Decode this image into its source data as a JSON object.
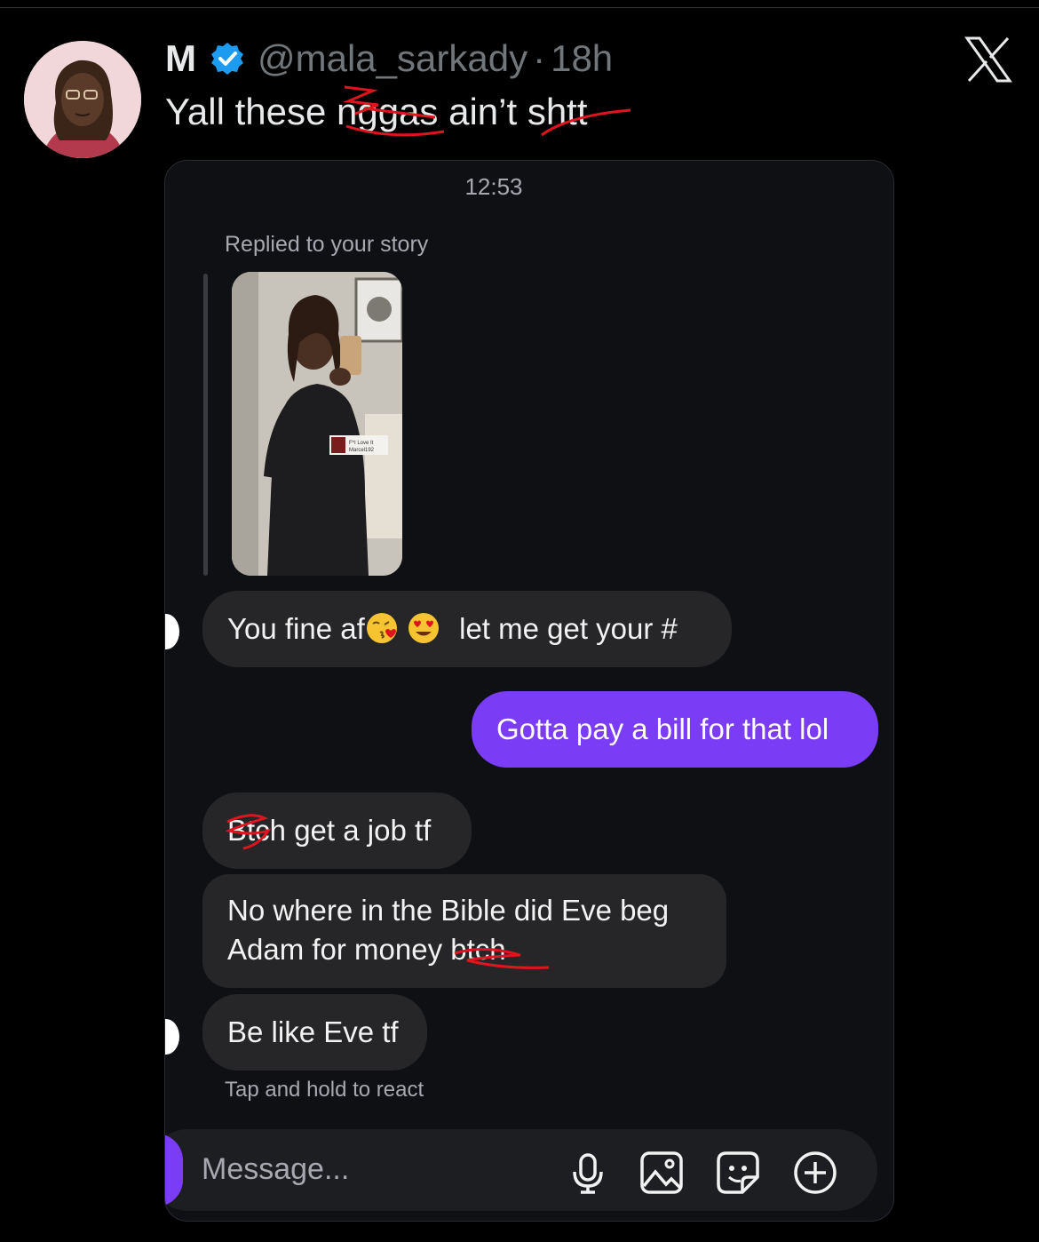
{
  "tweet": {
    "display_name": "M",
    "handle": "@mala_sarkady",
    "separator": "·",
    "age": "18h",
    "text": "Yall these n­ggas ain’t sh­tt",
    "text_display": "Yall these nggas ain’t shtt"
  },
  "dm": {
    "time": "12:53",
    "story_label": "Replied to your story",
    "story_sticker_line1": "F*I Love It",
    "story_sticker_line2": "Marcel192",
    "messages": [
      {
        "side": "received",
        "text_before": "You fine af",
        "text_after": "let me get your #",
        "emojis": [
          "kiss-emoji",
          "heart-eyes-emoji"
        ]
      },
      {
        "side": "sent",
        "text": "Gotta pay a bill for that lol"
      },
      {
        "side": "received",
        "text": "Btch get a job tf"
      },
      {
        "side": "received",
        "line1": "No where in the Bible did Eve beg",
        "line2": "Adam for money btch"
      },
      {
        "side": "received",
        "text": "Be like Eve tf"
      }
    ],
    "hint": "Tap and hold to react",
    "composer_placeholder": "Message...",
    "composer_icons": [
      "microphone-icon",
      "gallery-icon",
      "sticker-icon",
      "add-icon"
    ]
  },
  "colors": {
    "background": "#000000",
    "sent_bubble": "#7a3cf5",
    "received_bubble": "#262628",
    "verified": "#1d9bf0",
    "redaction": "#e0141e"
  }
}
